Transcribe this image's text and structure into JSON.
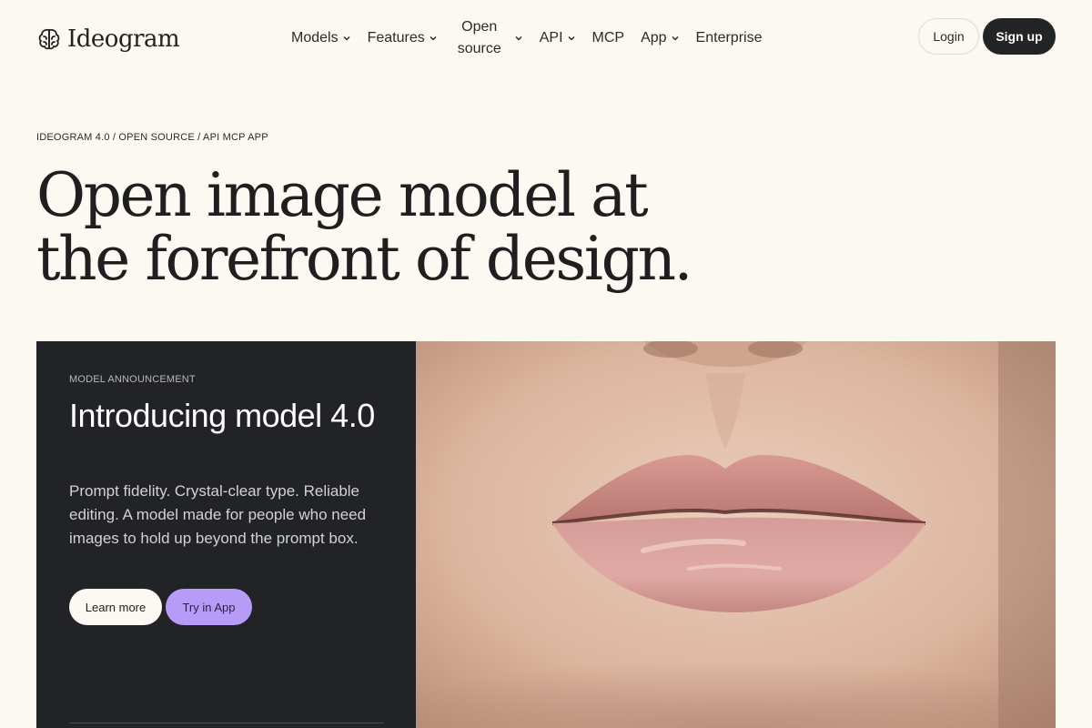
{
  "brand": {
    "name": "Ideogram"
  },
  "nav": {
    "items": [
      {
        "label": "Models",
        "dropdown": true
      },
      {
        "label": "Features",
        "dropdown": true
      },
      {
        "label": "Open source",
        "dropdown": true
      },
      {
        "label": "API",
        "dropdown": true
      },
      {
        "label": "MCP",
        "dropdown": false
      },
      {
        "label": "App",
        "dropdown": true
      },
      {
        "label": "Enterprise",
        "dropdown": false
      }
    ],
    "login": "Login",
    "signup": "Sign up"
  },
  "hero": {
    "breadcrumb": "IDEOGRAM 4.0 / OPEN SOURCE / API MCP APP",
    "title": "Open image model at the forefront of design."
  },
  "feature": {
    "eyebrow": "MODEL ANNOUNCEMENT",
    "title": "Introducing model 4.0",
    "description": "Prompt fidelity. Crystal-clear type. Reliable editing. A model made for people who need images to hold up beyond the prompt box.",
    "learn_more": "Learn more",
    "try_in_app": "Try in App",
    "image_subject": "close-up-lips-photo"
  },
  "colors": {
    "background": "#fcf8f2",
    "dark_card": "#222326",
    "accent_purple": "#b79cf7",
    "signup_bg": "#222426"
  }
}
